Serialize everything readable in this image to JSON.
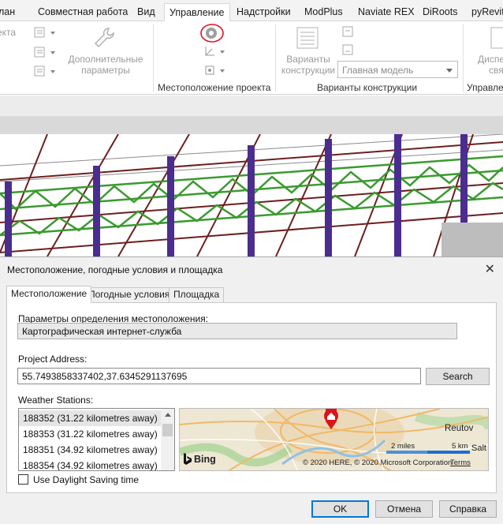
{
  "ribbon": {
    "tabs": [
      {
        "label": "лан",
        "active": false
      },
      {
        "label": "Совместная работа",
        "active": false
      },
      {
        "label": "Вид",
        "active": false
      },
      {
        "label": "Управление",
        "active": true
      },
      {
        "label": "Надстройки",
        "active": false
      },
      {
        "label": "ModPlus",
        "active": false
      },
      {
        "label": "Naviate REX",
        "active": false
      },
      {
        "label": "DiRoots",
        "active": false
      },
      {
        "label": "pyRevit",
        "active": false
      }
    ],
    "left_cut_label": "екта",
    "additional_params_line1": "Дополнительные",
    "additional_params_line2": "параметры",
    "panel_location": "Местоположение проекта",
    "design_options_line1": "Варианты",
    "design_options_line2": "конструкции",
    "main_model": "Главная модель",
    "panel_design_options": "Варианты конструкции",
    "right_cut_line1": "Диспе",
    "right_cut_line2": "свя",
    "right_cut_panel": "Управлен",
    "accent": "#e0141e"
  },
  "dialog": {
    "title": "Местоположение, погодные условия и площадка",
    "close_glyph": "✕",
    "tabs": [
      "Местоположение",
      "Погодные условия",
      "Площадка"
    ],
    "location_params_label": "Параметры определения местоположения:",
    "location_service": "Картографическая интернет-служба",
    "project_address_label": "Project Address:",
    "project_address_value": "55.7493858337402,37.6345291137695",
    "search_button": "Search",
    "weather_stations_label": "Weather Stations:",
    "stations": [
      "188352 (31.22 kilometres away)",
      "188353 (31.22 kilometres away)",
      "188351 (34.92 kilometres away)",
      "188354 (34.92 kilometres away)"
    ],
    "map": {
      "place_label": "Reutov",
      "place_label_2": "Salt",
      "scale_miles": "2 miles",
      "scale_km": "5 km",
      "provider": "Bing",
      "copyright": "© 2020 HERE, © 2020 Microsoft Corporation",
      "terms": "Terms",
      "pin_color": "#d9151c"
    },
    "dst_label": "Use Daylight Saving time",
    "ok_button": "OK",
    "cancel_button": "Отмена",
    "help_button": "Справка"
  }
}
